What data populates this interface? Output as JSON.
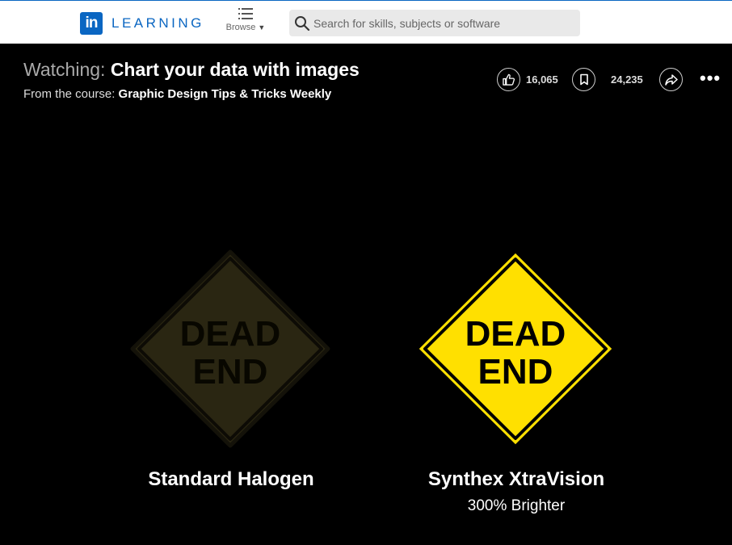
{
  "brand": {
    "logo": "in",
    "name": "LEARNING",
    "color": "#0a66c2"
  },
  "nav": {
    "browse_label": "Browse",
    "browse_icon": "list-icon",
    "caret_icon": "caret-down-icon"
  },
  "search": {
    "placeholder": "Search for skills, subjects or software",
    "icon": "search-icon"
  },
  "video": {
    "watching_prefix": "Watching:",
    "title": "Chart your data with images",
    "course_prefix": "From the course:",
    "course_name": "Graphic Design Tips & Tricks Weekly",
    "likes": "16,065",
    "saves": "24,235",
    "more_label": "•••"
  },
  "slide": {
    "left_sign": {
      "line1": "DEAD",
      "line2": "END",
      "caption": "Standard Halogen",
      "fill": "#2a2612"
    },
    "right_sign": {
      "line1": "DEAD",
      "line2": "END",
      "caption": "Synthex XtraVision",
      "subcaption": "300% Brighter",
      "fill": "#ffe000"
    }
  }
}
